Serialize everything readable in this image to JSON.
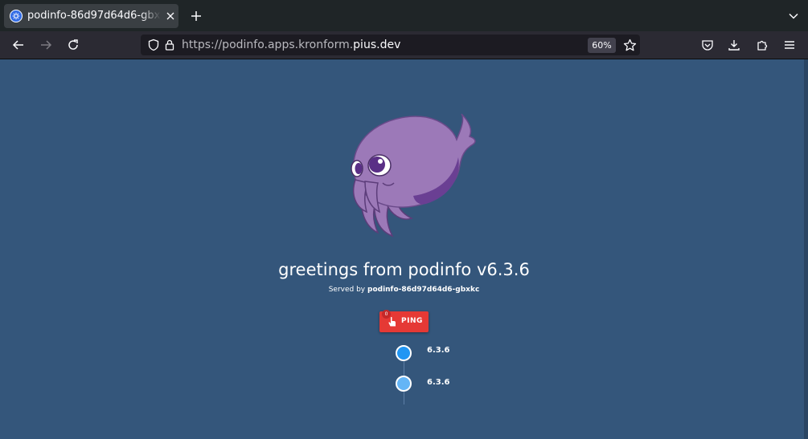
{
  "browser": {
    "tab": {
      "title": "podinfo-86d97d64d6-gbxkc"
    },
    "url": {
      "prefix": "https://podinfo.apps.kronform.",
      "domain": "pius.dev"
    },
    "zoom": "60%"
  },
  "icons": {
    "favicon": "kubernetes-icon",
    "close": "close-icon",
    "new_tab": "plus-icon",
    "tab_list": "chevron-down-icon",
    "back": "arrow-left-icon",
    "forward": "arrow-right-icon",
    "reload": "reload-icon",
    "shield": "shield-icon",
    "lock": "lock-icon",
    "bookmark": "star-icon",
    "pocket": "pocket-icon",
    "downloads": "download-icon",
    "extensions": "puzzle-icon",
    "menu": "hamburger-icon"
  },
  "page": {
    "greeting": "greetings from podinfo v6.3.6",
    "served_prefix": "Served by",
    "served_host": "podinfo-86d97d64d6-gbxkc",
    "ping": {
      "label": "PING",
      "count": "0"
    },
    "versions": [
      {
        "label": "6.3.6",
        "color": "#2196f3"
      },
      {
        "label": "6.3.6",
        "color": "#64b5f6"
      }
    ]
  },
  "colors": {
    "page_background": "#34567b",
    "ping_button": "#e53935",
    "mascot": "#9c79b8"
  }
}
